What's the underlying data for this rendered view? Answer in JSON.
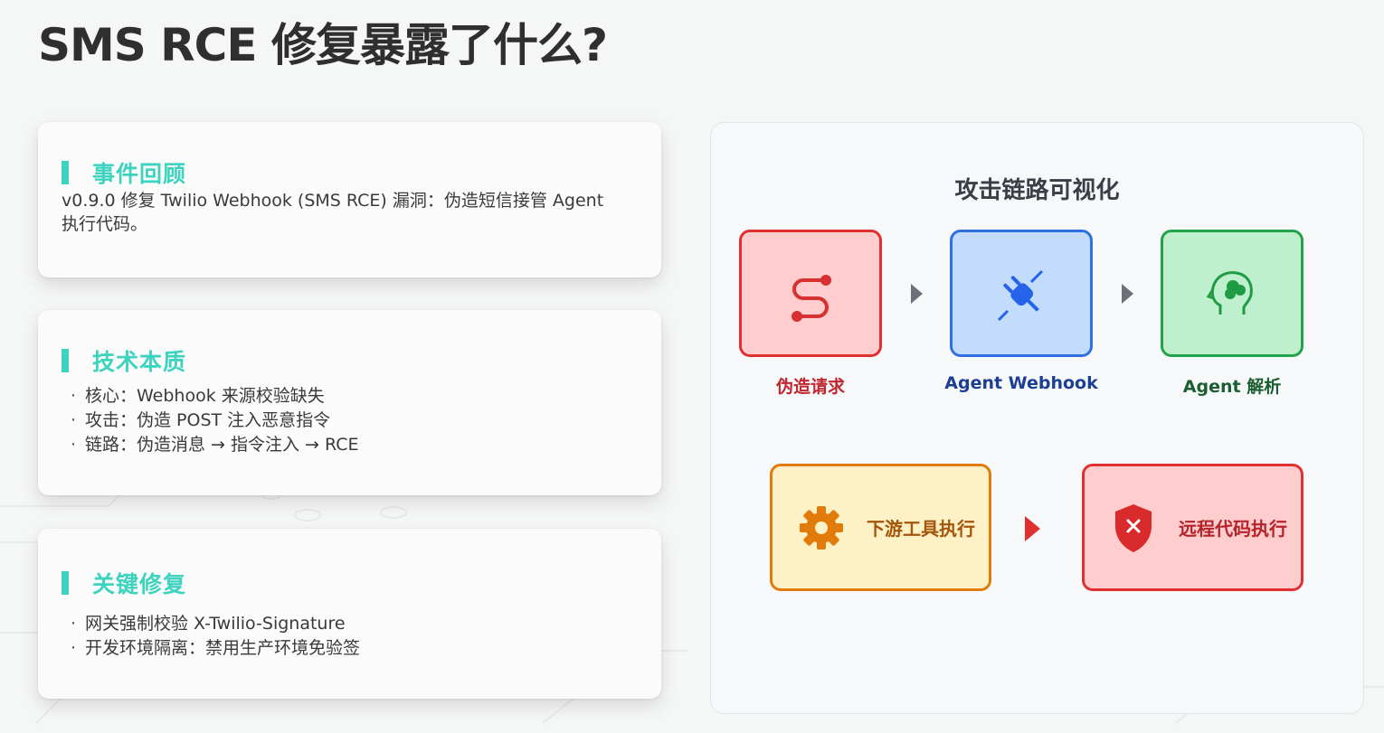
{
  "title": "SMS RCE 修复暴露了什么?",
  "cards": {
    "incident": {
      "title": "事件回顾",
      "text": "v0.9.0 修复 Twilio Webhook (SMS RCE) 漏洞：伪造短信接管 Agent 执行代码。"
    },
    "nature": {
      "title": "技术本质",
      "bullets": [
        "核心：Webhook 来源校验缺失",
        "攻击：伪造 POST 注入恶意指令",
        "链路：伪造消息 → 指令注入 → RCE"
      ]
    },
    "fix": {
      "title": "关键修复",
      "bullets": [
        "网关强制校验 X-Twilio-Signature",
        "开发环境隔离：禁用生产环境免验签"
      ]
    }
  },
  "diagram": {
    "title": "攻击链路可视化",
    "nodes": [
      {
        "label": "伪造请求",
        "icon": "route-icon",
        "color": "#e03131"
      },
      {
        "label": "Agent Webhook",
        "icon": "plug-icon",
        "color": "#2f6fe0"
      },
      {
        "label": "Agent 解析",
        "icon": "brain-head-icon",
        "color": "#22a34a"
      }
    ],
    "tiles": [
      {
        "label": "下游工具执行",
        "icon": "gear-icon",
        "color": "#e07b0c"
      },
      {
        "label": "远程代码执行",
        "icon": "shield-x-icon",
        "color": "#e03131"
      }
    ]
  },
  "colors": {
    "accent": "#3ed3be",
    "title": "#2f2f2f",
    "danger": "#e03131",
    "info": "#2f6fe0",
    "success": "#22a34a",
    "warning": "#e07b0c"
  }
}
